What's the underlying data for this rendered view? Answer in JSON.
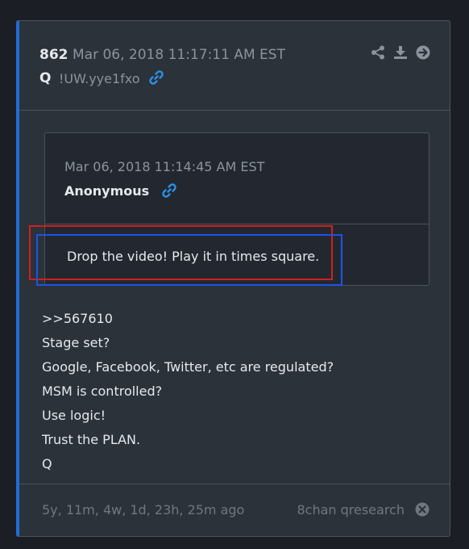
{
  "post": {
    "number": "862",
    "date": "Mar 06, 2018 11:17:11 AM EST",
    "author": "Q",
    "tripcode": "!UW.yye1fxo"
  },
  "quoted": {
    "date": "Mar 06, 2018 11:14:45 AM EST",
    "author": "Anonymous",
    "text": "Drop the video! Play it in times square."
  },
  "body_lines": [
    ">>567610",
    "Stage set?",
    "Google, Facebook, Twitter, etc are regulated?",
    "MSM is controlled?",
    "Use logic!",
    "Trust the PLAN.",
    "Q"
  ],
  "footer": {
    "age": "5y, 11m, 4w, 1d, 23h, 25m ago",
    "source": "8chan qresearch"
  },
  "icons": {
    "share": "share-icon",
    "download": "download-icon",
    "forward": "arrow-right-circle-icon",
    "link": "link-icon",
    "close": "close-circle-icon"
  },
  "colors": {
    "background": "#1b1f25",
    "card": "#2c323a",
    "accent": "#1f6ed4",
    "highlight_red": "#d11f1f",
    "highlight_blue": "#1a55e8"
  }
}
